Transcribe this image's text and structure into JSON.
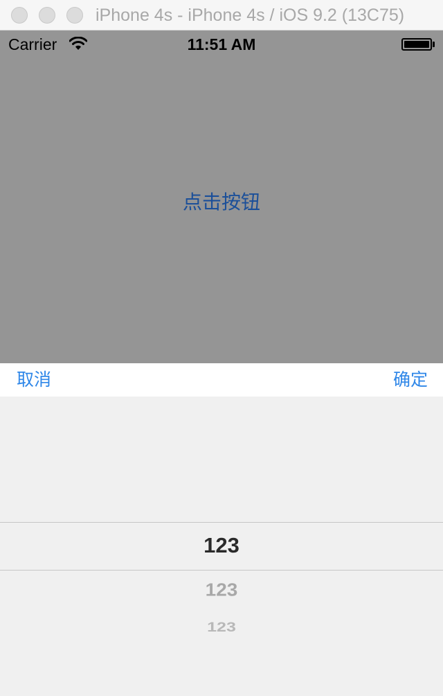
{
  "window": {
    "title": "iPhone 4s - iPhone 4s / iOS 9.2 (13C75)"
  },
  "status_bar": {
    "carrier": "Carrier",
    "time": "11:51 AM",
    "wifi_icon": "wifi-icon",
    "battery_icon": "battery-icon",
    "battery_level": 1.0
  },
  "main": {
    "button_label": "点击按钮"
  },
  "toolbar": {
    "cancel_label": "取消",
    "confirm_label": "确定"
  },
  "picker": {
    "selected": "123",
    "rows_below": [
      "123",
      "123"
    ]
  },
  "colors": {
    "dim_overlay": "#959595",
    "toolbar_tint": "#2f87e8",
    "main_button_text": "#1b4f99",
    "picker_background": "#f0f0f0"
  }
}
